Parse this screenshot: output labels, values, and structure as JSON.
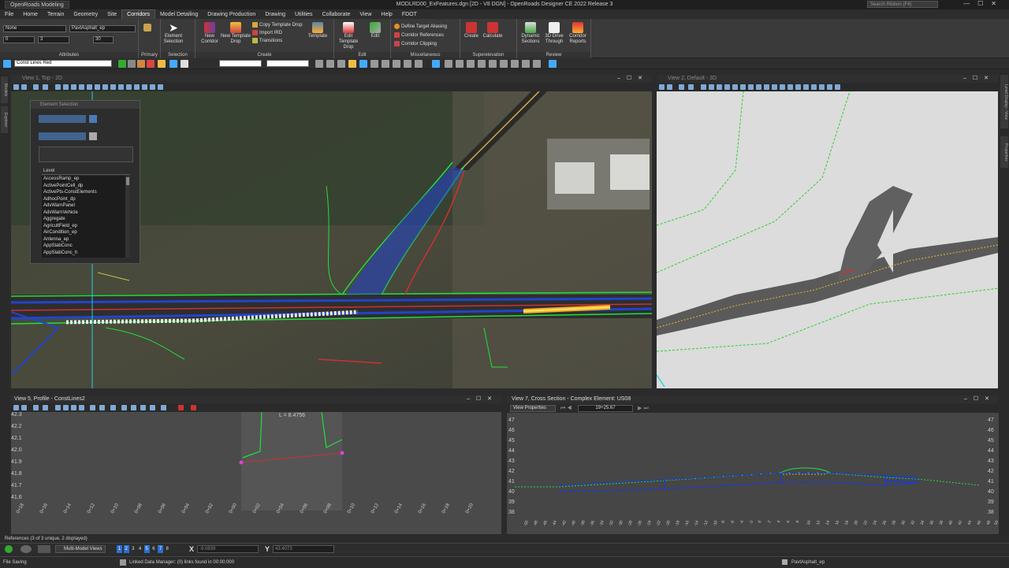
{
  "titlebar": {
    "workspace": "OpenRoads Modeling",
    "title": "MODLRD00_ExFeatures.dgn [2D - V8 DGN] - OpenRoads Designer CE 2022 Release 3",
    "search_placeholder": "Search Ribbon (F4)"
  },
  "menu": {
    "tabs": [
      "File",
      "Home",
      "Terrain",
      "Geometry",
      "Site",
      "Corridors",
      "Model Detailing",
      "Drawing Production",
      "Drawing",
      "Utilities",
      "Collaborate",
      "View",
      "Help",
      "FDOT"
    ],
    "active": "Corridors"
  },
  "ribbon": {
    "attributes": {
      "level_value": "None",
      "feature_value": "PavtAsphalt_ep",
      "color_value": "0",
      "style_value": "3",
      "weight_value": "30",
      "label": "Attributes"
    },
    "primary_label": "Primary",
    "selection": {
      "label": "Selection",
      "element_selection": "Element Selection"
    },
    "create": {
      "label": "Create",
      "new_corridor": "New Corridor",
      "new_template_drop": "New Template Drop",
      "copy_template_drop": "Copy Template Drop",
      "import_ird": "Import IRD",
      "transitions": "Transitions",
      "template": "Template"
    },
    "edit": {
      "label": "Edit",
      "edit_template_drop": "Edit Template Drop",
      "edit": "Edit"
    },
    "misc": {
      "label": "Miscellaneous",
      "define_target_aliasing": "Define Target Aliasing",
      "corridor_references": "Corridor References",
      "corridor_clipping": "Corridor Clipping"
    },
    "superelevation": {
      "label": "Superelevation",
      "create": "Create",
      "calculate": "Calculate"
    },
    "review": {
      "label": "Review",
      "dynamic_sections": "Dynamic Sections",
      "drive_through": "3D Drive Through",
      "corridor_reports": "Corridor Reports"
    }
  },
  "toolbar2": {
    "level_value": "Const Lines Red"
  },
  "left_strip": [
    "Models",
    "Explorer"
  ],
  "right_strip": [
    "Level Display - View",
    "Properties"
  ],
  "view1": {
    "title": "View 1, Top - 2D"
  },
  "view2": {
    "title": "View 2, Default - 3D"
  },
  "element_selection": {
    "title": "Element Selection",
    "level_header": "Level",
    "levels": [
      "AccessRamp_ep",
      "ActivePointCell_dp",
      "ActivePts-ConstElements",
      "AdhocPoint_dp",
      "AdvWarnPanel",
      "AdvWarnVehicle",
      "Aggregate",
      "AgricultField_ep",
      "AirCondition_ep",
      "Antenna_ep",
      "AppSlabConc",
      "AppSlabConc_h"
    ]
  },
  "view5": {
    "title": "View 5, Profile - ConstLines2",
    "annotation": "L = 8.4756",
    "y_ticks": [
      "42.3",
      "42.2",
      "42.1",
      "42.0",
      "41.9",
      "41.8",
      "41.7",
      "41.6"
    ],
    "x_ticks": [
      "0+18",
      "0+16",
      "0+14",
      "0+12",
      "0+10",
      "0+08",
      "0+06",
      "0+04",
      "0+02",
      "0+00",
      "0+02",
      "0+04",
      "0+06",
      "0+08",
      "0+10",
      "0+12",
      "0+14",
      "0+16",
      "0+18",
      "0+20"
    ]
  },
  "view7": {
    "title": "View 7, Cross Section - Complex Element: US08",
    "view_properties": "View Properties",
    "station": "19+25.67",
    "y_ticks": [
      "47",
      "46",
      "45",
      "44",
      "43",
      "42",
      "41",
      "40",
      "39",
      "38"
    ],
    "x_ticks": [
      "-50",
      "-48",
      "-46",
      "-44",
      "-42",
      "-40",
      "-38",
      "-36",
      "-34",
      "-32",
      "-30",
      "-28",
      "-26",
      "-24",
      "-22",
      "-20",
      "-18",
      "-16",
      "-14",
      "-12",
      "-10",
      "-8",
      "-6",
      "-4",
      "-2",
      "0",
      "2",
      "4",
      "6",
      "8",
      "10",
      "12",
      "14",
      "16",
      "18",
      "20",
      "22",
      "24",
      "26",
      "28",
      "30",
      "32",
      "34",
      "36",
      "38",
      "40",
      "42",
      "44",
      "46",
      "48",
      "50"
    ]
  },
  "references": "References (3 of 3 unique, 2 displayed)",
  "status": {
    "view_mode": "Multi-Model Views",
    "view_numbers": [
      "1",
      "2",
      "3",
      "4",
      "5",
      "6",
      "7",
      "8"
    ],
    "x_label": "X",
    "x_value": "-9.0839",
    "y_label": "Y",
    "y_value": "43.4073",
    "message": "File Saving",
    "linked_data": "Linked Data Manager: (0) links found in 00:00:000",
    "feature": "PavtAsphalt_ep"
  }
}
